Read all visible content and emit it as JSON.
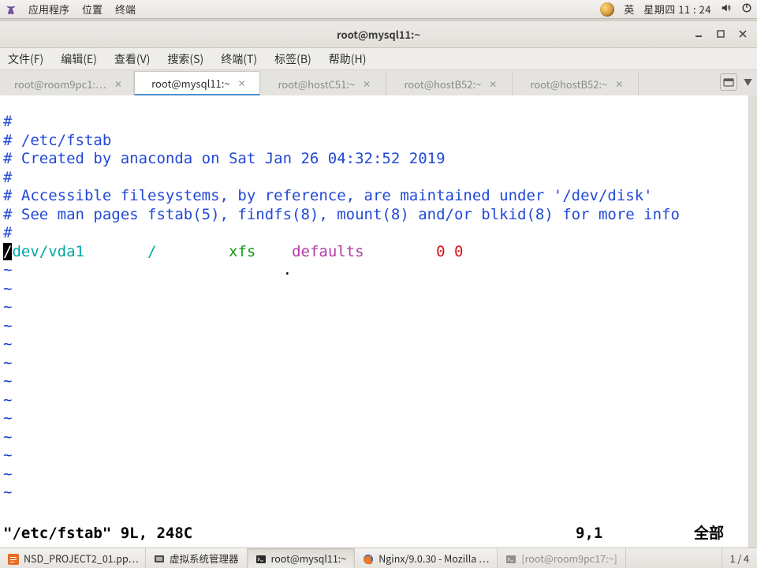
{
  "panel": {
    "apps": "应用程序",
    "places": "位置",
    "terminal": "终端",
    "ime": "英",
    "clock": "星期四 11 : 24"
  },
  "window": {
    "title": "root@mysql11:~"
  },
  "menubar": {
    "file": "文件(F)",
    "edit": "编辑(E)",
    "view": "查看(V)",
    "search": "搜索(S)",
    "terminal": "终端(T)",
    "tabs": "标签(B)",
    "help": "帮助(H)"
  },
  "tabs": [
    {
      "label": "root@room9pc1:…",
      "active": false
    },
    {
      "label": "root@mysql11:~",
      "active": true
    },
    {
      "label": "root@hostC51:~",
      "active": false
    },
    {
      "label": "root@hostB52:~",
      "active": false
    },
    {
      "label": "root@hostB52:~",
      "active": false
    }
  ],
  "vim": {
    "comments": [
      "#",
      "# /etc/fstab",
      "# Created by anaconda on Sat Jan 26 04:32:52 2019",
      "#",
      "# Accessible filesystems, by reference, are maintained under '/dev/disk'",
      "# See man pages fstab(5), findfs(8), mount(8) and/or blkid(8) for more info",
      "#"
    ],
    "entry": {
      "dev_first": "/",
      "dev_rest": "dev/vda1",
      "mnt": "/",
      "fs": "xfs",
      "opts": "defaults",
      "dump": "0",
      "pass": "0"
    },
    "status_file": "\"/etc/fstab\" 9L, 248C",
    "ruler": "9,1",
    "tail": "全部"
  },
  "tasks": [
    {
      "label": "NSD_PROJECT2_01.pp…",
      "kind": "wps",
      "state": "normal"
    },
    {
      "label": "虚拟系统管理器",
      "kind": "virtman",
      "state": "normal"
    },
    {
      "label": "root@mysql11:~",
      "kind": "terminal",
      "state": "active"
    },
    {
      "label": "Nginx/9.0.30 - Mozilla …",
      "kind": "firefox",
      "state": "normal"
    },
    {
      "label": "[root@room9pc17:~]",
      "kind": "terminal",
      "state": "inactive"
    }
  ],
  "pager": "1 / 4"
}
